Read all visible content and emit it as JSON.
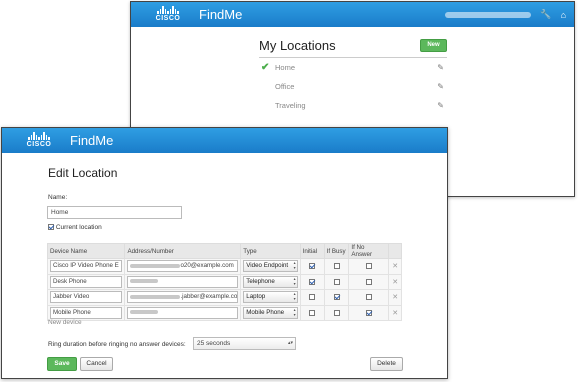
{
  "brand": {
    "logo_text": "CISCO",
    "app_name": "FindMe"
  },
  "colors": {
    "titlebar": "#1a7cc9",
    "accent_green": "#5cb85c",
    "check_blue": "#2a5db0"
  },
  "locations_window": {
    "title": "My Locations",
    "new_button": "New",
    "toolbar_icons": [
      "wrench-icon",
      "home-icon"
    ],
    "items": [
      {
        "label": "Home",
        "current": true
      },
      {
        "label": "Office",
        "current": false
      },
      {
        "label": "Traveling",
        "current": false
      }
    ]
  },
  "edit_window": {
    "title": "Edit Location",
    "name_label": "Name:",
    "name_value": "Home",
    "current_location_label": "Current location",
    "current_location_checked": true,
    "columns": [
      "Device Name",
      "Address/Number",
      "Type",
      "Initial",
      "If Busy",
      "If No Answer"
    ],
    "devices": [
      {
        "name": "Cisco IP Video Phone E",
        "address": "o20@example.com",
        "type": "Video Endpoint",
        "initial": true,
        "busy": false,
        "no_answer": false
      },
      {
        "name": "Desk Phone",
        "address": "",
        "type": "Telephone",
        "initial": true,
        "busy": false,
        "no_answer": false
      },
      {
        "name": "Jabber Video",
        "address": ".jabber@example.co",
        "type": "Laptop",
        "initial": false,
        "busy": true,
        "no_answer": false
      },
      {
        "name": "Mobile Phone",
        "address": "",
        "type": "Mobile Phone",
        "initial": false,
        "busy": false,
        "no_answer": true
      }
    ],
    "new_device_link": "New device",
    "ring_label": "Ring duration before ringing no answer devices:",
    "ring_value": "25 seconds",
    "save_button": "Save",
    "cancel_button": "Cancel",
    "delete_button": "Delete"
  }
}
